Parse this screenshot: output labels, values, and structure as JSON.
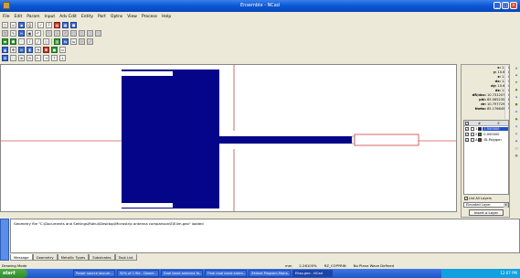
{
  "window": {
    "title": "Ensemble - NCad"
  },
  "menu": [
    "File",
    "Edit",
    "Param",
    "Input",
    "Adv Edit",
    "Entity",
    "Port",
    "Optns",
    "View",
    "Process",
    "Help"
  ],
  "toolbar1": [
    "new",
    "open",
    "save",
    "print",
    "check",
    "help",
    "layers",
    "gds",
    "off"
  ],
  "toolbar2": [
    "copy",
    "cut",
    "paste",
    "draw",
    "undo",
    "redo",
    "snap",
    "grid",
    "p1",
    "p2",
    "p3",
    "p4"
  ],
  "toolbar3": [
    "rect",
    "poly",
    "arc",
    "path",
    "line",
    "via",
    "align",
    "flip",
    "mirror",
    "rotate",
    "scale"
  ],
  "toolbar4": [
    "sel",
    "move",
    "stretch",
    "port",
    "rad",
    "ref",
    "ant"
  ],
  "toolbar5": [
    "zoom-box",
    "zoom-fit",
    "zoom-in",
    "zoom-out",
    "pan-left",
    "pan-right",
    "pan-up",
    "pan-down"
  ],
  "coords": {
    "x": "1.45",
    "y": "10.675",
    "z": "1.55",
    "dx": "1.45",
    "dy": "10.675",
    "dz": "1.55",
    "dr": "10.73120725",
    "phi": "85.56523523",
    "dr2": "10.79772959",
    "theta": "85.17664537"
  },
  "coord_labels": {
    "x": "x:",
    "y": "y:",
    "z": "z:",
    "dx": "dx:",
    "dy": "dy:",
    "dz": "dz:",
    "dr": "dR/dxx:",
    "phi": "phi:",
    "dr2": "dr:",
    "theta": "theta:"
  },
  "layers": {
    "headers": [
      "#",
      "Z"
    ],
    "rows": [
      {
        "num": "1",
        "value": "1.550000",
        "color": "#12128a",
        "selected": true
      },
      {
        "num": "2",
        "value": "0.000000",
        "color": "#12a012",
        "selected": false
      },
      {
        "num": "A",
        "value": "ID-Polygon",
        "color": "#c01818",
        "selected": false
      }
    ]
  },
  "list_all_label": "List All Layers",
  "layer_dropdown": "Elevated Layer",
  "insert_layer_label": "Insert a Layer",
  "message": "Geometry file \"C:\\Documents and Settings\\Rahul\\Desktop\\Microstrip antenna comparison\\E\\E4m.geo\" loaded",
  "tabs": [
    "Message",
    "Geometry",
    "Metallic Types",
    "Substrates",
    "Task List"
  ],
  "status": {
    "mode": "Drawing Mode",
    "unit": "mm",
    "zoom": "2.26105%",
    "rz": "RZ_COPYRIN",
    "plane_wave": "No Plane Wave Defined"
  },
  "taskbar": {
    "start": "start",
    "items": [
      "Power source docum...",
      "50% of 1 file - Downl...",
      "Dual band antenna fo...",
      "Final dual band anten...",
      "Zeland Program Mana...",
      "Ellap.geo - NCad"
    ],
    "clock": "12:07 PM"
  },
  "colors": {
    "patch": "#05058a",
    "feed_line": "#c00000",
    "titlebar": "#0a56d6"
  }
}
